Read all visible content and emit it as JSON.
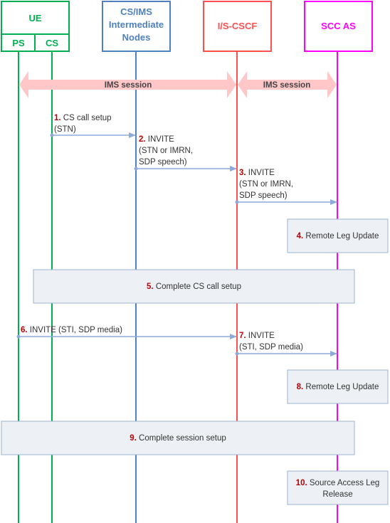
{
  "colors": {
    "ue": "#00b050",
    "intermediate": "#4f81bd",
    "cscf": "#ff4f4f",
    "sccas": "#ff00ff",
    "message_line": "#8eaadb",
    "step_number": "#c00000",
    "box_fill": "#edf0f5",
    "box_border": "#9cb3d1",
    "session_arrow": "#ffc7c7"
  },
  "participants": {
    "ue": {
      "label": "UE",
      "sub": [
        "PS",
        "CS"
      ]
    },
    "intermediate": {
      "label_lines": [
        "CS/IMS",
        "Intermediate",
        "Nodes"
      ]
    },
    "cscf": {
      "label": "I/S-CSCF"
    },
    "sccas": {
      "label": "SCC AS"
    }
  },
  "sessions": [
    {
      "label": "IMS session",
      "from": "ps",
      "to": "cscf"
    },
    {
      "label": "IMS session",
      "from": "cscf",
      "to": "sccas"
    }
  ],
  "steps": [
    {
      "num": "1.",
      "lines": [
        "CS call setup",
        "(STN)"
      ],
      "from": "cs",
      "to": "intermediate"
    },
    {
      "num": "2.",
      "lines": [
        "INVITE",
        "(STN or IMRN,",
        "SDP speech)"
      ],
      "from": "intermediate",
      "to": "cscf"
    },
    {
      "num": "3.",
      "lines": [
        "INVITE",
        "(STN or IMRN,",
        "SDP speech)"
      ],
      "from": "cscf",
      "to": "sccas"
    },
    {
      "num": "4.",
      "lines": [
        "Remote Leg Update"
      ],
      "type": "box"
    },
    {
      "num": "5.",
      "lines": [
        "Complete CS call setup"
      ],
      "type": "box"
    },
    {
      "num": "6.",
      "lines": [
        "INVITE (STI, SDP media)"
      ],
      "from": "ps",
      "to": "cscf"
    },
    {
      "num": "7.",
      "lines": [
        "INVITE",
        "(STI, SDP media)"
      ],
      "from": "cscf",
      "to": "sccas"
    },
    {
      "num": "8.",
      "lines": [
        "Remote Leg Update"
      ],
      "type": "box"
    },
    {
      "num": "9.",
      "lines": [
        "Complete session setup"
      ],
      "type": "box"
    },
    {
      "num": "10.",
      "lines": [
        "Source Access Leg",
        "Release"
      ],
      "type": "box"
    }
  ]
}
